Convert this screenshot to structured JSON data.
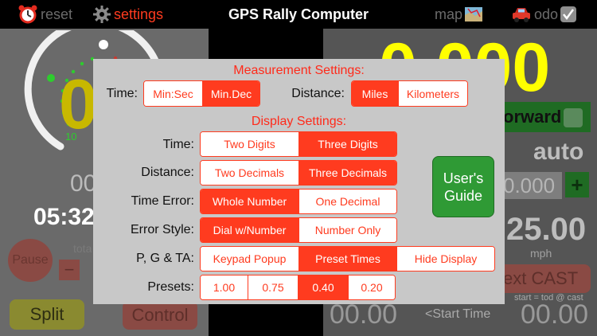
{
  "topbar": {
    "reset_label": "reset",
    "settings_label": "settings",
    "title": "GPS Rally Computer",
    "map_label": "map",
    "odo_label": "odo"
  },
  "background": {
    "big_digit": "0",
    "dial_label": "10",
    "small_value": "00",
    "time_value": "05:32",
    "total_label": "tota",
    "pause_label": "Pause",
    "minus_label": "−",
    "split_label": "Split",
    "control_label": "Control",
    "distance_value": "0.000",
    "forward_label": "orward",
    "mode_label": "auto",
    "adjust_value": "0.000",
    "plus_label": "+",
    "speed_value": "25.00",
    "speed_unit": "mph",
    "cast_label": "ext CAST",
    "start_note": "start = tod @ cast",
    "bottom_left_value": "00.00",
    "start_time_label": "<Start Time",
    "bottom_right_value": "00.00"
  },
  "dialog": {
    "measurement_title": "Measurement Settings:",
    "display_title": "Display Settings:",
    "measure_time_label": "Time:",
    "measure_time_options": [
      "Min:Sec",
      "Min.Dec"
    ],
    "distance_unit_label": "Distance:",
    "distance_unit_options": [
      "Miles",
      "Kilometers"
    ],
    "rows": [
      {
        "label": "Time:",
        "options": [
          "Two Digits",
          "Three Digits"
        ],
        "selected": 1
      },
      {
        "label": "Distance:",
        "options": [
          "Two Decimals",
          "Three Decimals"
        ],
        "selected": 1
      },
      {
        "label": "Time Error:",
        "options": [
          "Whole Number",
          "One Decimal"
        ],
        "selected": 0
      },
      {
        "label": "Error Style:",
        "options": [
          "Dial w/Number",
          "Number Only"
        ],
        "selected": 0
      },
      {
        "label": "P, G & TA:",
        "options": [
          "Keypad Popup",
          "Preset Times",
          "Hide Display"
        ],
        "selected": 1
      },
      {
        "label": "Presets:",
        "options": [
          "1.00",
          "0.75",
          "0.40",
          "0.20"
        ],
        "selected": 2
      }
    ],
    "guide_label": "User's Guide"
  },
  "colors": {
    "accent": "#ff3b1f",
    "dialog_bg": "#c8c8c8",
    "guide_green": "#2f9a35",
    "distance_yellow": "#ffff00"
  }
}
